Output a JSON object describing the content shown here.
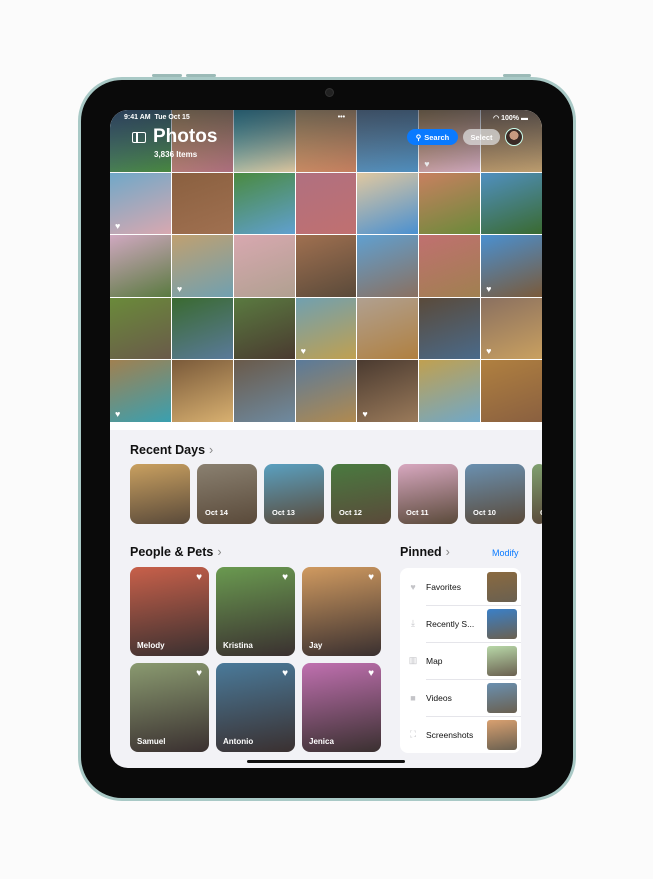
{
  "status_bar": {
    "time": "9:41 AM",
    "date": "Tue Oct 15",
    "battery": "100%",
    "dots": "•••"
  },
  "header": {
    "title": "Photos",
    "item_count": "3,836 Items",
    "search_label": "Search",
    "select_label": "Select"
  },
  "recent_days": {
    "title": "Recent Days",
    "days": [
      {
        "label": ""
      },
      {
        "label": "Oct 14"
      },
      {
        "label": "Oct 13"
      },
      {
        "label": "Oct 12"
      },
      {
        "label": "Oct 11"
      },
      {
        "label": "Oct 10"
      },
      {
        "label": "O"
      }
    ]
  },
  "people_pets": {
    "title": "People & Pets",
    "people": [
      {
        "name": "Melody"
      },
      {
        "name": "Kristina"
      },
      {
        "name": "Jay"
      },
      {
        "name": "Samuel"
      },
      {
        "name": "Antonio"
      },
      {
        "name": "Jenica"
      }
    ]
  },
  "pinned": {
    "title": "Pinned",
    "modify_label": "Modify",
    "items": [
      {
        "label": "Favorites",
        "icon": "heart-icon"
      },
      {
        "label": "Recently S...",
        "icon": "tray-download-icon"
      },
      {
        "label": "Map",
        "icon": "map-icon"
      },
      {
        "label": "Videos",
        "icon": "video-icon"
      },
      {
        "label": "Screenshots",
        "icon": "screenshot-icon"
      }
    ]
  },
  "colors": {
    "accent": "#0a7aff",
    "device_frame": "#a9c9c6"
  }
}
